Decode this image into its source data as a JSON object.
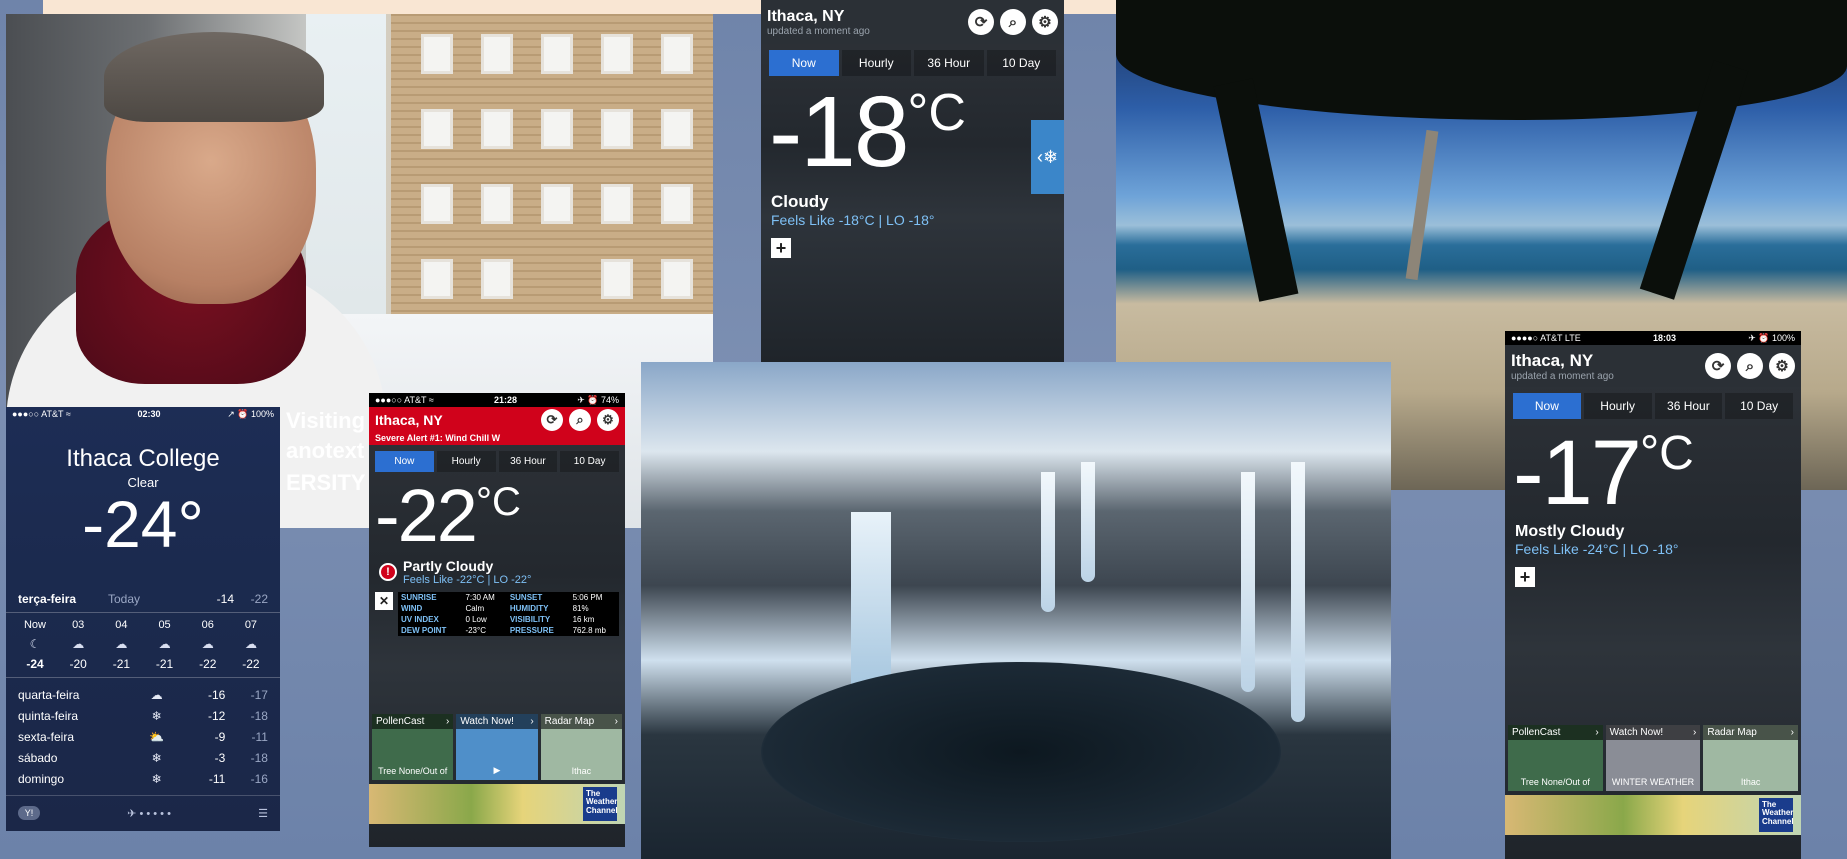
{
  "overlay_text": {
    "line1": "Visiting",
    "line2": "anotext",
    "line3": "ERSITY"
  },
  "ios_weather": {
    "status": {
      "carrier": "●●●○○ AT&T ≈",
      "time": "02:30",
      "battery": "↗ ⏰ 100%"
    },
    "city": "Ithaca College",
    "condition": "Clear",
    "temp": "-24°",
    "today": {
      "day": "terça-feira",
      "label": "Today",
      "hi": "-14",
      "lo": "-22"
    },
    "hours": [
      "Now",
      "03",
      "04",
      "05",
      "06",
      "07"
    ],
    "hour_icons": [
      "☾",
      "☁",
      "☁",
      "☁",
      "☁",
      "☁"
    ],
    "hour_temps": [
      "-24",
      "-20",
      "-21",
      "-21",
      "-22",
      "-22"
    ],
    "days": [
      {
        "name": "quarta-feira",
        "icon": "☁",
        "hi": "-16",
        "lo": "-17"
      },
      {
        "name": "quinta-feira",
        "icon": "❄",
        "hi": "-12",
        "lo": "-18"
      },
      {
        "name": "sexta-feira",
        "icon": "⛅",
        "hi": "-9",
        "lo": "-11"
      },
      {
        "name": "sábado",
        "icon": "❄",
        "hi": "-3",
        "lo": "-18"
      },
      {
        "name": "domingo",
        "icon": "❄",
        "hi": "-11",
        "lo": "-16"
      }
    ],
    "footer": {
      "brand": "Y!",
      "dots": "✈ • • • • •",
      "list": "☰"
    }
  },
  "twc_alert": {
    "status": {
      "carrier": "●●●○○ AT&T ≈",
      "time": "21:28",
      "battery": "✈ ⏰ 74%"
    },
    "city": "Ithaca, NY",
    "alert": "Severe Alert #1: Wind Chill W",
    "tabs": [
      "Now",
      "Hourly",
      "36 Hour",
      "10 Day"
    ],
    "temp": "-22",
    "unit": "°C",
    "condition": "Partly Cloudy",
    "feels": "Feels Like -22°C |  LO -22°",
    "details": [
      [
        "SUNRISE",
        "7:30 AM",
        "SUNSET",
        "5:06 PM"
      ],
      [
        "WIND",
        "Calm",
        "HUMIDITY",
        "81%"
      ],
      [
        "UV INDEX",
        "0 Low",
        "VISIBILITY",
        "16 km"
      ],
      [
        "DEW POINT",
        "-23°C",
        "PRESSURE",
        "762.8 mb"
      ]
    ],
    "tiles": [
      {
        "title": "PollenCast",
        "sub": "Tree\nNone/Out of"
      },
      {
        "title": "Watch Now!",
        "sub": ""
      },
      {
        "title": "Radar Map",
        "sub": "Ithac"
      }
    ],
    "ad_brand": "The Weather Channel"
  },
  "twc_top": {
    "city": "Ithaca, NY",
    "updated": "updated a moment ago",
    "tabs": [
      "Now",
      "Hourly",
      "36 Hour",
      "10 Day"
    ],
    "temp": "-18",
    "unit": "°C",
    "condition": "Cloudy",
    "feels": "Feels Like -18°C |  LO -18°"
  },
  "twc_right": {
    "status": {
      "carrier": "●●●●○ AT&T  LTE",
      "time": "18:03",
      "battery": "✈ ⏰ 100%"
    },
    "city": "Ithaca, NY",
    "updated": "updated a moment ago",
    "tabs": [
      "Now",
      "Hourly",
      "36 Hour",
      "10 Day"
    ],
    "temp": "-17",
    "unit": "°C",
    "condition": "Mostly Cloudy",
    "feels": "Feels Like -24°C |  LO -18°",
    "tiles": [
      {
        "title": "PollenCast",
        "sub": "Tree\nNone/Out of"
      },
      {
        "title": "Watch Now!",
        "sub": "WINTER WEATHER"
      },
      {
        "title": "Radar Map",
        "sub": "Ithac"
      }
    ],
    "ad_brand": "The Weather Channel"
  },
  "colors": {
    "accent": "#2c6fd1",
    "alert": "#d0021b",
    "feels": "#7ec0f5",
    "slide_bg": "#7c8fb2"
  },
  "icons": {
    "refresh": "refresh-icon",
    "search": "search-icon",
    "settings": "gear-icon",
    "add": "plus-icon"
  }
}
